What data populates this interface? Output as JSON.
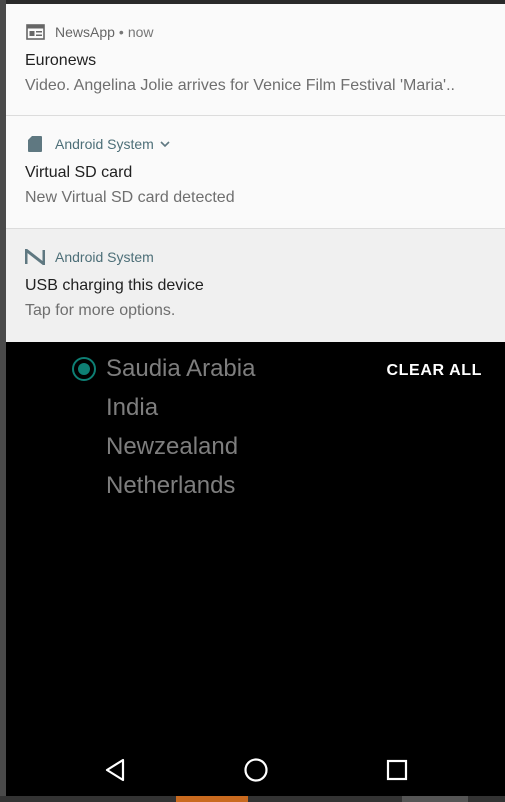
{
  "notifications": [
    {
      "app": "NewsApp",
      "separator": "•",
      "time": "now",
      "icon": "newspaper-icon",
      "title": "Euronews",
      "body": "Video. Angelina Jolie arrives for Venice Film Festival 'Maria'.."
    },
    {
      "app": "Android System",
      "icon": "sd-card-icon",
      "expand_icon": "chevron-down-icon",
      "title": "Virtual SD card",
      "body": "New Virtual SD card detected"
    },
    {
      "app": "Android System",
      "icon": "android-n-icon",
      "title": "USB charging this device",
      "body": "Tap for more options."
    }
  ],
  "clear_all_label": "CLEAR ALL",
  "radio_options": [
    {
      "label": "Saudia Arabia",
      "selected": true
    },
    {
      "label": "India",
      "selected": false
    },
    {
      "label": "Newzealand",
      "selected": false
    },
    {
      "label": "Netherlands",
      "selected": false
    }
  ],
  "navbar": {
    "back_icon": "back-triangle-icon",
    "home_icon": "home-circle-icon",
    "recents_icon": "recents-square-icon"
  },
  "colors": {
    "accent": "#0e7f74",
    "app_name_teal": "#4d6f78",
    "background": "#000000"
  }
}
